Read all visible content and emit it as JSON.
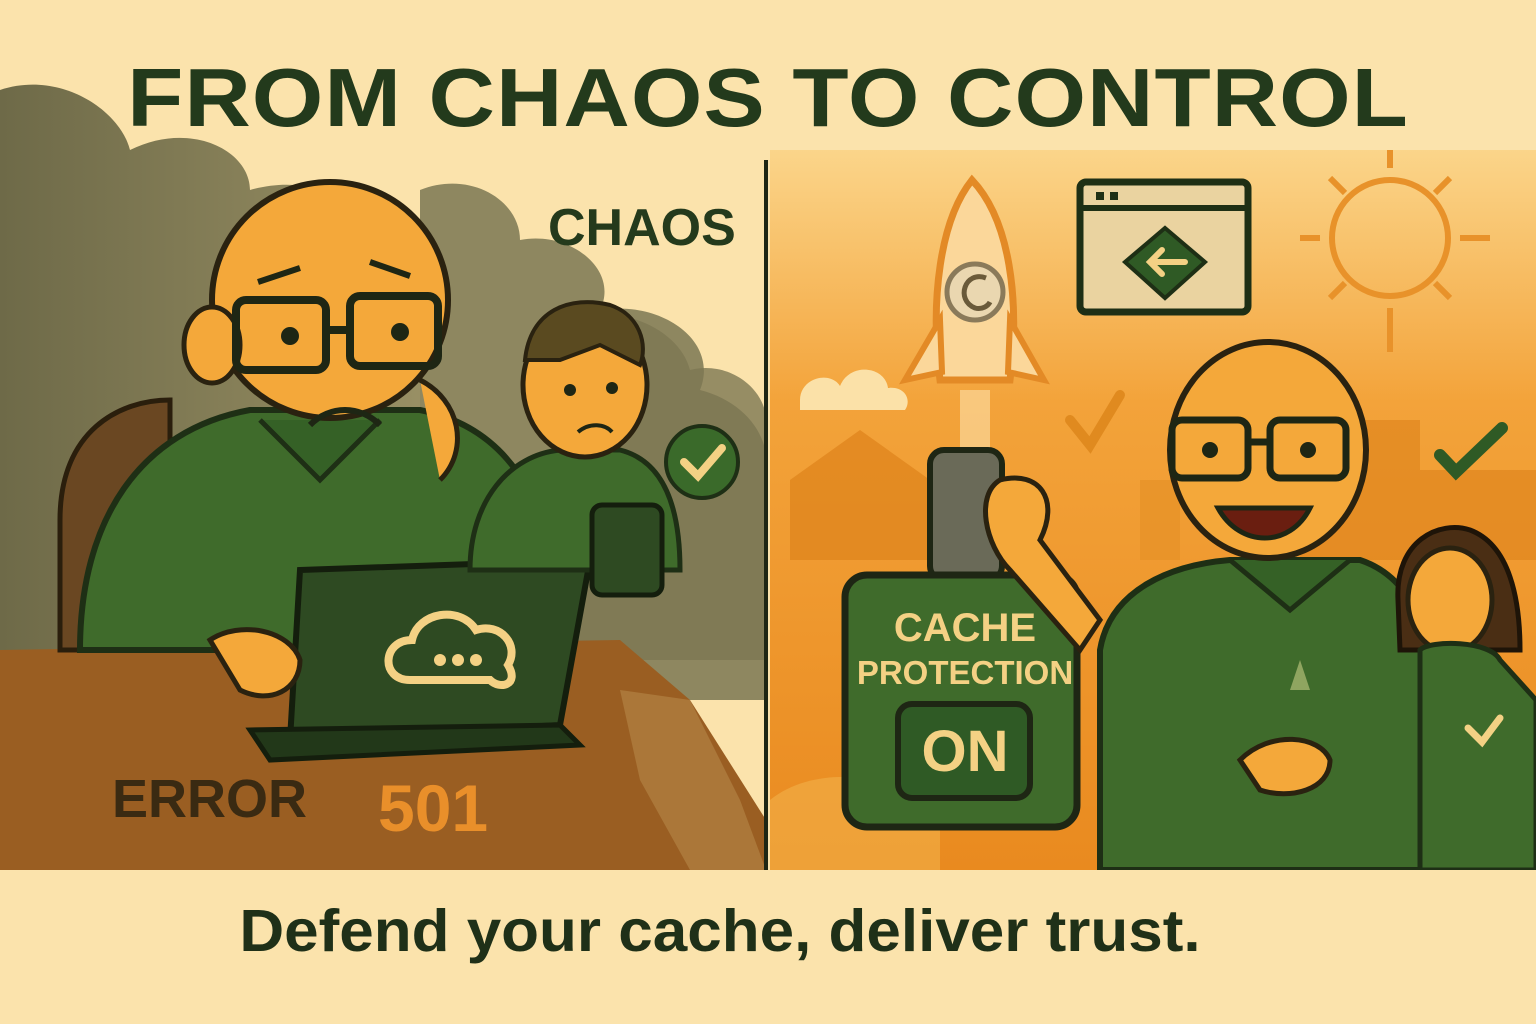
{
  "headline": "FROM CHAOS TO CONTROL",
  "left_panel": {
    "label": "CHAOS",
    "error_word": "ERROR",
    "error_code": "501"
  },
  "right_panel": {
    "switch_line1": "CACHE",
    "switch_line2": "PROTECTION",
    "switch_state": "ON"
  },
  "tagline": "Defend your cache, deliver trust.",
  "icons": [
    "cloud-chat-icon",
    "check-icon",
    "rocket-icon",
    "browser-back-icon",
    "sun-icon",
    "tree-icon"
  ],
  "colors": {
    "background": "#fbe3ac",
    "dark_green": "#2f5a25",
    "headline": "#233a1c",
    "orange": "#e98f2a",
    "skin": "#f4a83a",
    "smoke": "#6e6a48"
  }
}
